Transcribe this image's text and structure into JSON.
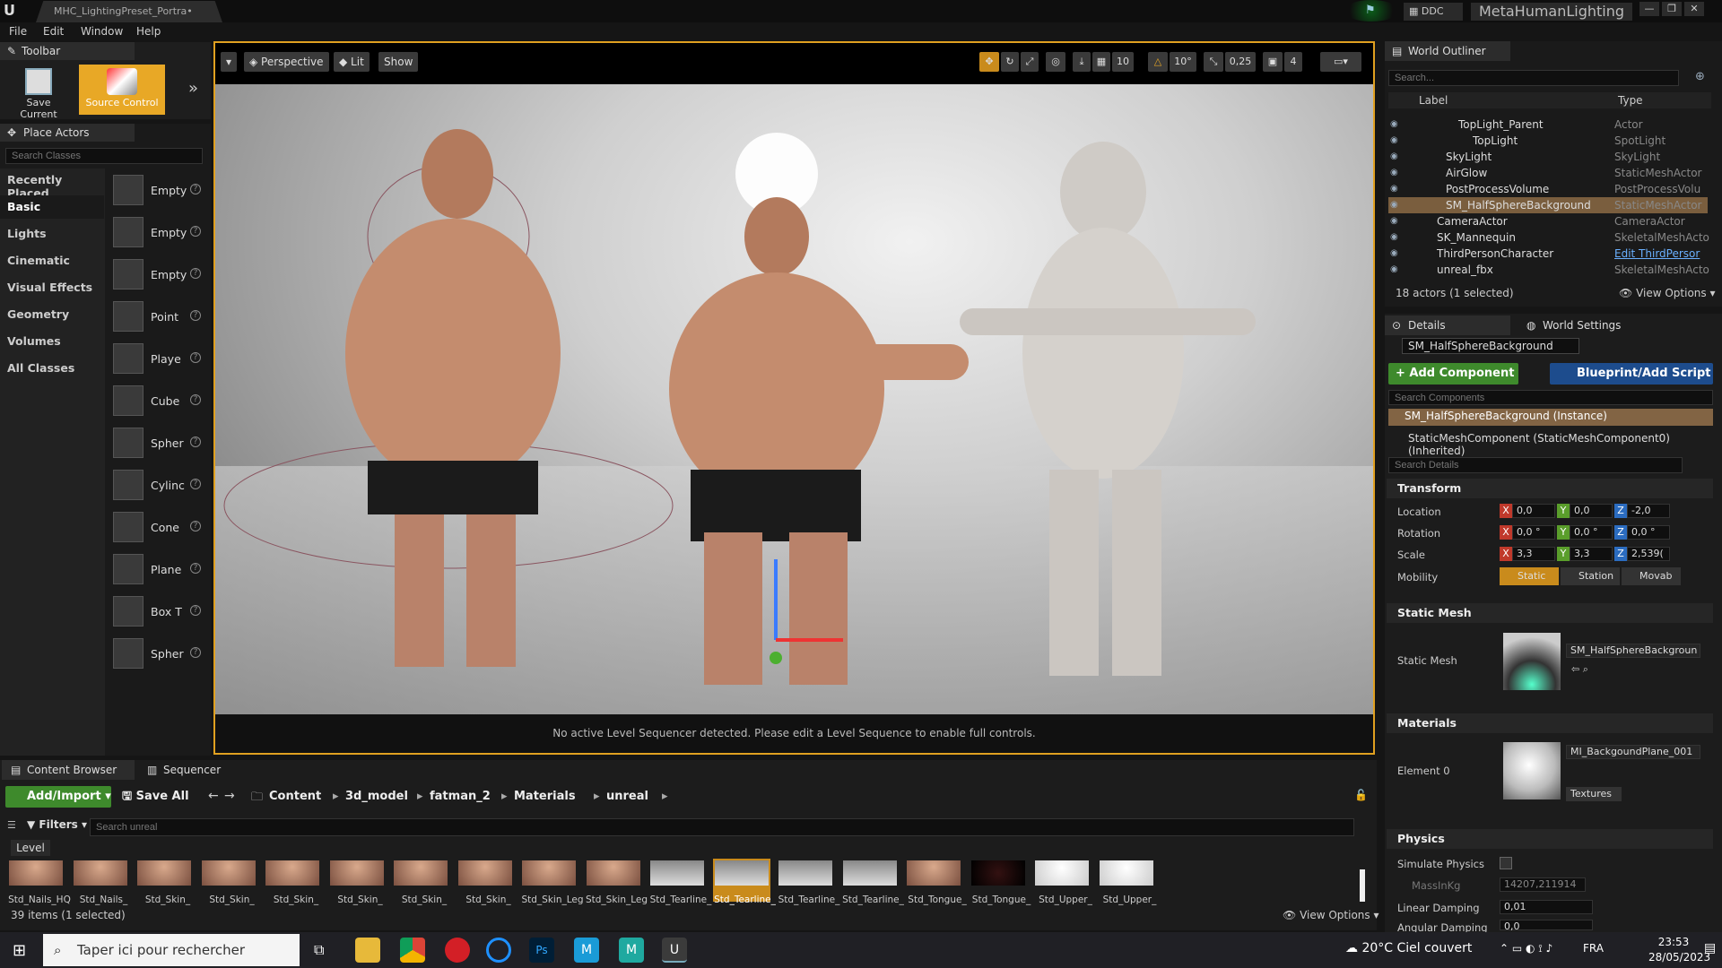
{
  "window": {
    "tab_title": "MHC_LightingPreset_Portra•",
    "project_name": "MetaHumanLighting",
    "ddc_label": "DDC"
  },
  "menu": [
    "File",
    "Edit",
    "Window",
    "Help"
  ],
  "toolbar": {
    "tab_label": "Toolbar",
    "save_current": "Save Current",
    "source_control": "Source Control"
  },
  "place_actors": {
    "tab_label": "Place Actors",
    "search_placeholder": "Search Classes",
    "categories": [
      "Recently Placed",
      "Basic",
      "Lights",
      "Cinematic",
      "Visual Effects",
      "Geometry",
      "Volumes",
      "All Classes"
    ],
    "selected_category": "Basic",
    "items": [
      "Empty",
      "Empty",
      "Empty",
      "Point",
      "Playe",
      "Cube",
      "Spher",
      "Cylinc",
      "Cone",
      "Plane",
      "Box T",
      "Spher"
    ]
  },
  "viewport": {
    "perspective": "Perspective",
    "lit": "Lit",
    "show": "Show",
    "grid_value": "10",
    "rot_value": "10°",
    "scale_value": "0,25",
    "cam_speed": "4",
    "status": "No active Level Sequencer detected. Please edit a Level Sequence to enable full controls."
  },
  "outliner": {
    "tab_label": "World Outliner",
    "search_placeholder": "Search...",
    "col_label": "Label",
    "col_type": "Type",
    "rows": [
      {
        "label": "TopLight_Parent",
        "type": "Actor"
      },
      {
        "label": "TopLight",
        "type": "SpotLight"
      },
      {
        "label": "SkyLight",
        "type": "SkyLight"
      },
      {
        "label": "AirGlow",
        "type": "StaticMeshActor"
      },
      {
        "label": "PostProcessVolume",
        "type": "PostProcessVolu"
      },
      {
        "label": "SM_HalfSphereBackground",
        "type": "StaticMeshActor"
      },
      {
        "label": "CameraActor",
        "type": "CameraActor"
      },
      {
        "label": "SK_Mannequin",
        "type": "SkeletalMeshActo"
      },
      {
        "label": "ThirdPersonCharacter",
        "type": "Edit ThirdPersor"
      },
      {
        "label": "unreal_fbx",
        "type": "SkeletalMeshActo"
      }
    ],
    "selected_row": "SM_HalfSphereBackground",
    "footer": "18 actors (1 selected)",
    "view_options": "View Options"
  },
  "details": {
    "tab_label": "Details",
    "world_settings": "World Settings",
    "actor_name": "SM_HalfSphereBackground",
    "add_component": "Add Component",
    "blueprint_script": "Blueprint/Add Script",
    "search_components": "Search Components",
    "instance": "SM_HalfSphereBackground (Instance)",
    "mesh_component": "StaticMeshComponent (StaticMeshComponent0) (Inherited)",
    "search_details": "Search Details",
    "transform": {
      "section": "Transform",
      "location_label": "Location",
      "rotation_label": "Rotation",
      "scale_label": "Scale",
      "mobility_label": "Mobility",
      "location": [
        "0,0",
        "0,0",
        "-2,0"
      ],
      "rotation": [
        "0,0 °",
        "0,0 °",
        "0,0 °"
      ],
      "scale": [
        "3,3",
        "3,3",
        "2,539("
      ],
      "mobility": [
        "Static",
        "Station",
        "Movab"
      ]
    },
    "static_mesh": {
      "section": "Static Mesh",
      "label": "Static Mesh",
      "value": "SM_HalfSphereBackgroun"
    },
    "materials": {
      "section": "Materials",
      "label": "Element 0",
      "value": "MI_BackgoundPlane_001",
      "textures": "Textures"
    },
    "physics": {
      "section": "Physics",
      "simulate": "Simulate Physics",
      "mass": "MassInKg",
      "mass_value": "14207,211914",
      "linear_damping": "Linear Damping",
      "linear_value": "0,01",
      "angular_damping": "Angular Damping",
      "angular_value": "0,0"
    }
  },
  "content_browser": {
    "tab_label": "Content Browser",
    "sequencer_tab": "Sequencer",
    "add_import": "Add/Import",
    "save_all": "Save All",
    "breadcrumb": [
      "Content",
      "3d_model",
      "fatman_2",
      "Materials",
      "unreal"
    ],
    "filters": "Filters",
    "search_placeholder": "Search unreal",
    "level": "Level",
    "assets": [
      "Std_Nails_HQ",
      "Std_Nails_",
      "Std_Skin_",
      "Std_Skin_",
      "Std_Skin_",
      "Std_Skin_",
      "Std_Skin_",
      "Std_Skin_",
      "Std_Skin_Leg",
      "Std_Skin_Leg",
      "Std_Tearline_",
      "Std_Tearline_",
      "Std_Tearline_",
      "Std_Tearline_",
      "Std_Tongue_",
      "Std_Tongue_",
      "Std_Upper_",
      "Std_Upper_"
    ],
    "selected_asset": 11,
    "count": "39 items (1 selected)",
    "view_options": "View Options"
  },
  "taskbar": {
    "search_placeholder": "Taper ici pour rechercher",
    "weather": "20°C  Ciel couvert",
    "lang": "FRA",
    "time": "23:53",
    "date": "28/05/2023"
  },
  "colors": {
    "accent": "#e8a826",
    "green": "#3e8a2c",
    "blue": "#1d4c8d"
  }
}
